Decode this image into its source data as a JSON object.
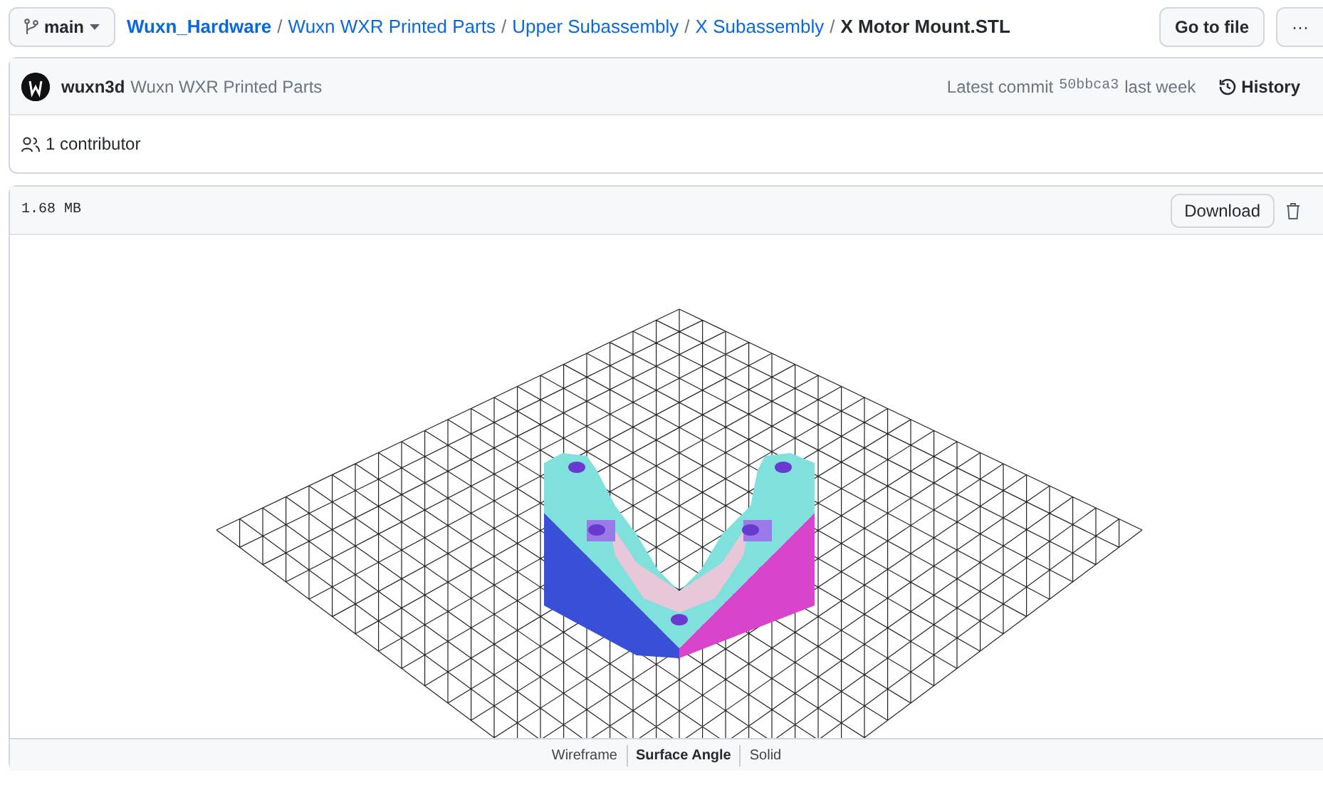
{
  "branch": {
    "label": "main"
  },
  "breadcrumb": [
    {
      "kind": "repo",
      "text": "Wuxn_Hardware"
    },
    {
      "kind": "sep",
      "text": "/"
    },
    {
      "kind": "dir",
      "text": "Wuxn WXR Printed Parts"
    },
    {
      "kind": "sep",
      "text": "/"
    },
    {
      "kind": "dir",
      "text": "Upper Subassembly"
    },
    {
      "kind": "sep",
      "text": "/"
    },
    {
      "kind": "dir",
      "text": "X Subassembly"
    },
    {
      "kind": "sep",
      "text": "/"
    },
    {
      "kind": "file",
      "text": "X Motor Mount.STL"
    }
  ],
  "actions": {
    "go_to_file": "Go to file",
    "more": "···"
  },
  "commit": {
    "author": "wuxn3d",
    "message": "Wuxn WXR Printed Parts",
    "latest_label": "Latest commit",
    "sha": "50bbca3",
    "when": "last week",
    "history": "History"
  },
  "contributors": "1 contributor",
  "file": {
    "size": "1.68 MB",
    "download": "Download"
  },
  "viewer": {
    "modes": [
      {
        "label": "Wireframe",
        "selected": false
      },
      {
        "label": "Surface Angle",
        "selected": true
      },
      {
        "label": "Solid",
        "selected": false
      }
    ]
  }
}
